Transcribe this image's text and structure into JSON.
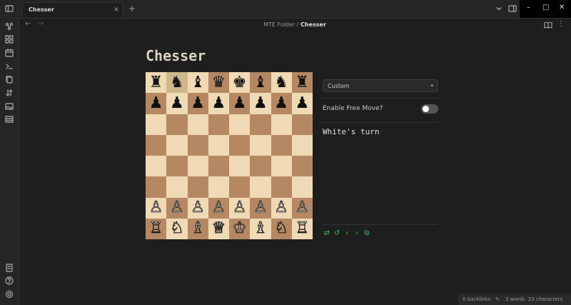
{
  "tab": {
    "label": "Chesser",
    "new_tab": "+",
    "close": "×"
  },
  "window": {
    "minimize": "–",
    "maximize": "□",
    "close": "✕"
  },
  "nav": {
    "back": "←",
    "forward": "→",
    "more": "⋮"
  },
  "breadcrumb": {
    "folder": "MTE Folder",
    "separator": " / ",
    "current": "Chesser"
  },
  "page": {
    "title": "Chesser"
  },
  "board": {
    "light_color": "#f0d9b5",
    "dark_color": "#b58863",
    "highlight_squares": [
      "b8"
    ],
    "ranks": [
      [
        "♜",
        "♞",
        "♝",
        "♛",
        "♚",
        "♝",
        "♞",
        "♜"
      ],
      [
        "♟",
        "♟",
        "♟",
        "♟",
        "♟",
        "♟",
        "♟",
        "♟"
      ],
      [
        "",
        "",
        "",
        "",
        "",
        "",
        "",
        ""
      ],
      [
        "",
        "",
        "",
        "",
        "",
        "",
        "",
        ""
      ],
      [
        "",
        "",
        "",
        "",
        "",
        "",
        "",
        ""
      ],
      [
        "",
        "",
        "",
        "",
        "",
        "",
        "",
        ""
      ],
      [
        "♙",
        "♙",
        "♙",
        "♙",
        "♙",
        "♙",
        "♙",
        "♙"
      ],
      [
        "♖",
        "♘",
        "♗",
        "♕",
        "♔",
        "♗",
        "♘",
        "♖"
      ]
    ]
  },
  "side": {
    "select_value": "Custom",
    "caret": "▾",
    "free_move_label": "Enable Free Move?",
    "free_move_enabled": false,
    "turn_text": "White's turn",
    "controls": [
      "⇄",
      "↺",
      "‹",
      "›",
      "⧉"
    ]
  },
  "status": {
    "backlinks": "0 backlinks",
    "words": "3 words",
    "characters": "23 characters",
    "edit_icon": "✎"
  },
  "ribbon_icons": [
    "graph-icon",
    "grid-icon",
    "calendar-icon",
    "terminal-icon",
    "copy-icon",
    "sort-icon",
    "image-icon",
    "table-icon"
  ],
  "ribbon_bottom_icons": [
    "vault-icon",
    "help-icon",
    "settings-icon"
  ],
  "accent_color": "#3fbf5f"
}
